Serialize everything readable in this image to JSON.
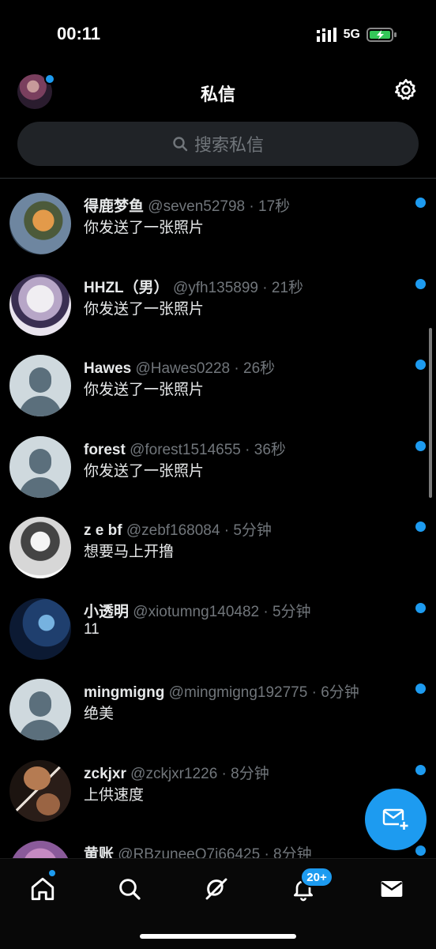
{
  "status_bar": {
    "time": "00:11",
    "network": "5G"
  },
  "header": {
    "title": "私信"
  },
  "search": {
    "placeholder": "搜索私信"
  },
  "conversations": [
    {
      "name": "得鹿梦鱼",
      "handle": "@seven52798",
      "time": "17秒",
      "preview": "你发送了一张照片"
    },
    {
      "name": "HHZL（男）",
      "handle": "@yfh135899",
      "time": "21秒",
      "preview": "你发送了一张照片"
    },
    {
      "name": "Hawes",
      "handle": "@Hawes0228",
      "time": "26秒",
      "preview": "你发送了一张照片"
    },
    {
      "name": "forest",
      "handle": "@forest1514655",
      "time": "36秒",
      "preview": "你发送了一张照片"
    },
    {
      "name": "z e bf",
      "handle": "@zebf168084",
      "time": "5分钟",
      "preview": "想要马上开撸"
    },
    {
      "name": "小透明",
      "handle": "@xiotumng140482",
      "time": "5分钟",
      "preview": "11"
    },
    {
      "name": "mingmigng",
      "handle": "@mingmigng192775",
      "time": "6分钟",
      "preview": "绝美"
    },
    {
      "name": "zckjxr",
      "handle": "@zckjxr1226",
      "time": "8分钟",
      "preview": "上供速度"
    },
    {
      "name": "黄账",
      "handle": "@RBzuneeQ7i66425",
      "time": "8分钟",
      "preview": ""
    }
  ],
  "tab_bar": {
    "notifications_badge": "20+"
  },
  "colors": {
    "accent": "#1d9bf0",
    "background": "#000000",
    "muted": "#71767b"
  },
  "icons": [
    "gear-icon",
    "search-icon",
    "new-message-icon",
    "home-icon",
    "explore-icon",
    "grok-icon",
    "bell-icon",
    "mail-icon"
  ]
}
